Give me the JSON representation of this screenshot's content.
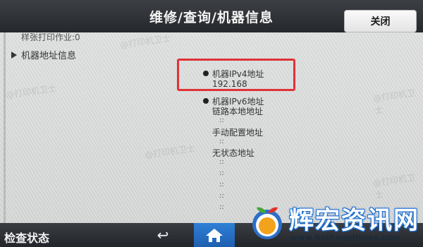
{
  "header": {
    "title": "维修/查询/机器信息",
    "close_label": "关闭"
  },
  "main": {
    "previous_item": "样张打印作业:0",
    "section_title": "机器地址信息",
    "ipv4": {
      "label": "机器IPv4地址",
      "value": "192.168"
    },
    "ipv6": {
      "label": "机器IPv6地址",
      "link_local": "链路本地地址",
      "manual": "手动配置地址",
      "stateless": "无状态地址"
    },
    "separator": "::"
  },
  "footer": {
    "status_label": "检查状态"
  },
  "logo": {
    "text": "辉宏资讯网",
    "url": "www.huihongjituan.com"
  },
  "watermark": "@打印机卫士"
}
